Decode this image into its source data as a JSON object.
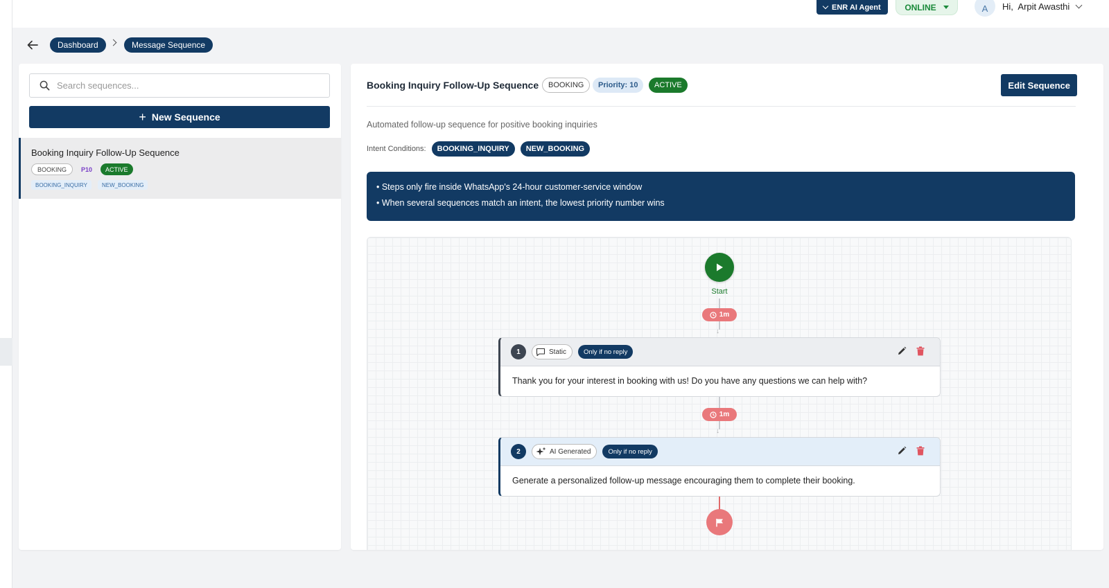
{
  "header": {
    "agent_label": "ENR AI Agent",
    "status_label": "ONLINE",
    "avatar_initial": "A",
    "greeting": "Hi,  Arpit Awasthi"
  },
  "breadcrumb": {
    "items": [
      "Dashboard",
      "Message Sequence"
    ]
  },
  "sidebar": {
    "search_placeholder": "Search sequences...",
    "new_button": "New Sequence",
    "sequences": [
      {
        "title": "Booking Inquiry Follow-Up Sequence",
        "category": "BOOKING",
        "priority": "P10",
        "status": "ACTIVE",
        "intents": [
          "BOOKING_INQUIRY",
          "NEW_BOOKING"
        ]
      }
    ]
  },
  "detail": {
    "title": "Booking Inquiry Follow-Up Sequence",
    "category": "BOOKING",
    "priority": "Priority: 10",
    "status": "ACTIVE",
    "edit_button": "Edit Sequence",
    "description": "Automated follow-up sequence for positive booking inquiries",
    "intent_label": "Intent Conditions:",
    "intents": [
      "BOOKING_INQUIRY",
      "NEW_BOOKING"
    ],
    "info": [
      "• Steps only fire inside WhatsApp's 24-hour customer-service window",
      "• When several sequences match an intent, the lowest priority number wins"
    ]
  },
  "flow": {
    "start_label": "Start",
    "delays": [
      "1m",
      "1m"
    ],
    "steps": [
      {
        "number": "1",
        "type": "Static",
        "type_icon": "chat-bubble-icon",
        "condition": "Only if no reply",
        "message": "Thank you for your interest in booking with us! Do you have any questions we can help with?"
      },
      {
        "number": "2",
        "type": "AI Generated",
        "type_icon": "sparkles-icon",
        "condition": "Only if no reply",
        "message": "Generate a personalized follow-up message encouraging them to complete their booking."
      }
    ]
  },
  "colors": {
    "primary": "#123a63",
    "active_green": "#1b7a2c",
    "delay_red": "#e9787b",
    "delete_red": "#e05560"
  }
}
